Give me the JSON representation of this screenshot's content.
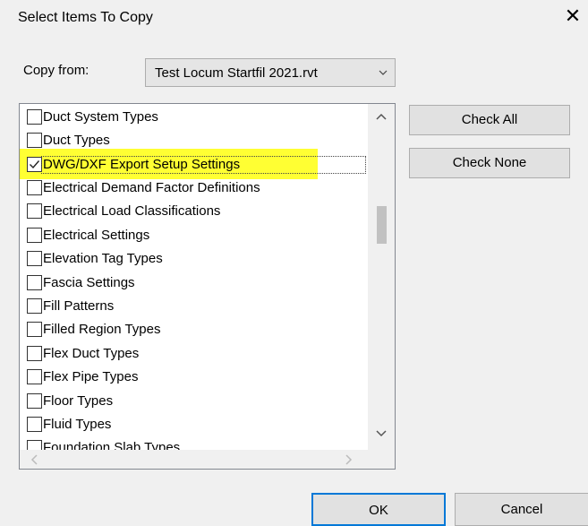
{
  "dialog": {
    "title": "Select Items To Copy",
    "close_glyph": "✕"
  },
  "copy_from": {
    "label": "Copy from:",
    "selected": "Test Locum Startfil 2021.rvt"
  },
  "items": [
    {
      "label": "Duct System Types",
      "checked": false
    },
    {
      "label": "Duct Types",
      "checked": false
    },
    {
      "label": "DWG/DXF Export Setup Settings",
      "checked": true,
      "highlighted": true
    },
    {
      "label": "Electrical Demand Factor Definitions",
      "checked": false
    },
    {
      "label": "Electrical Load Classifications",
      "checked": false
    },
    {
      "label": "Electrical Settings",
      "checked": false
    },
    {
      "label": "Elevation Tag Types",
      "checked": false
    },
    {
      "label": "Fascia Settings",
      "checked": false
    },
    {
      "label": "Fill Patterns",
      "checked": false
    },
    {
      "label": "Filled Region Types",
      "checked": false
    },
    {
      "label": "Flex Duct Types",
      "checked": false
    },
    {
      "label": "Flex Pipe Types",
      "checked": false
    },
    {
      "label": "Floor Types",
      "checked": false
    },
    {
      "label": "Fluid Types",
      "checked": false
    },
    {
      "label": "Foundation Slab Types",
      "checked": false
    }
  ],
  "buttons": {
    "check_all": "Check All",
    "check_none": "Check None",
    "ok": "OK",
    "cancel": "Cancel"
  },
  "colors": {
    "highlight": "#ffff33",
    "default_button_border": "#0078d7"
  }
}
